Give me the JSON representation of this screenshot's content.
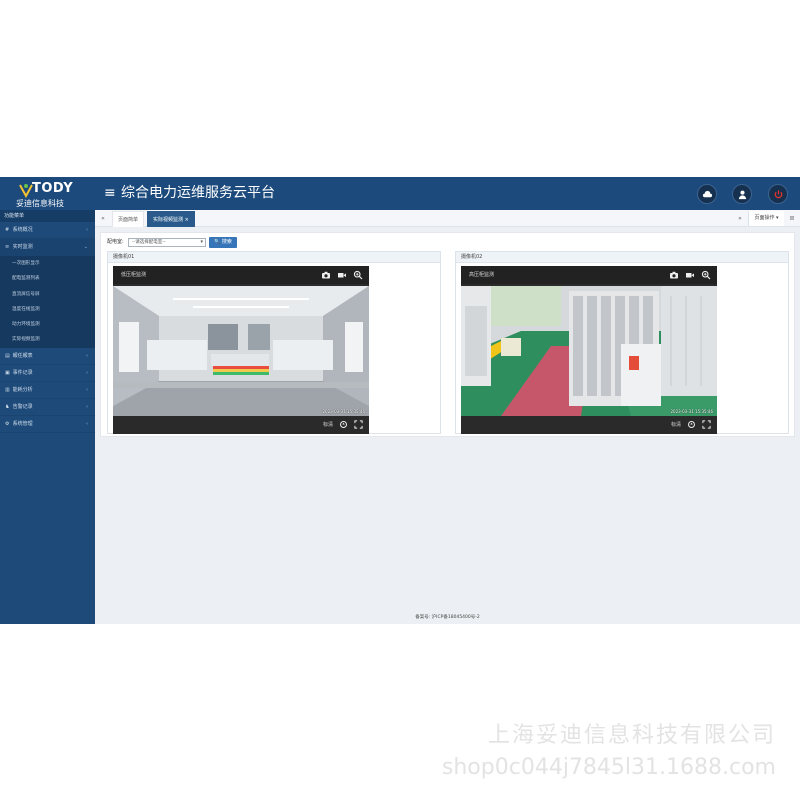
{
  "header": {
    "logo_text": "TODY",
    "logo_sub": "妥迪信息科技",
    "menu_icon": "≡",
    "title": "综合电力运维服务云平台",
    "icons": [
      "cloud-icon",
      "user-icon",
      "power-icon"
    ],
    "colors": {
      "bar": "#1c4a7c",
      "power": "#e0342b"
    }
  },
  "sidebar": {
    "heading": "功能菜单",
    "items": [
      {
        "icon": "#",
        "label": "系统概况",
        "arrow": "‹",
        "open": false
      },
      {
        "icon": "≋",
        "label": "实时监测",
        "arrow": "⌄",
        "open": true,
        "children": [
          "一次图形显示",
          "配电监测列表",
          "直流屏信号屏",
          "温度在线监测",
          "动力环境监测",
          "实际视频监测"
        ]
      },
      {
        "icon": "▤",
        "label": "報任報表",
        "arrow": "‹",
        "open": false
      },
      {
        "icon": "▣",
        "label": "事件记录",
        "arrow": "‹",
        "open": false
      },
      {
        "icon": "▥",
        "label": "能耗分析",
        "arrow": "‹",
        "open": false
      },
      {
        "icon": "♞",
        "label": "告警记录",
        "arrow": "‹",
        "open": false
      },
      {
        "icon": "⚙",
        "label": "系统管理",
        "arrow": "‹",
        "open": false
      }
    ]
  },
  "tabs": {
    "prev": "«",
    "next": "»",
    "items": [
      {
        "label": "页面简单",
        "active": false
      },
      {
        "label": "实际视频监测 ×",
        "active": true
      }
    ],
    "operation": "页面操作 ▾",
    "close": "⊠"
  },
  "filter": {
    "label": "配电室:",
    "select_value": "--请选择配电室--",
    "search_label": "🔍 搜索"
  },
  "cameras": [
    {
      "card_title": "摄像机01",
      "name": "低压柜监测",
      "timestamp": "2023-03-31 15:35:46",
      "quality": "标清"
    },
    {
      "card_title": "摄像机02",
      "name": "高压柜监测",
      "timestamp": "2023-03-31 15:35:46",
      "quality": "标清"
    }
  ],
  "footer": {
    "text": "备案号: 沪ICP备18045400号-2"
  },
  "watermark": {
    "line1": "上海妥迪信息科技有限公司",
    "line2": "shop0c044j7845l31.1688.com"
  }
}
